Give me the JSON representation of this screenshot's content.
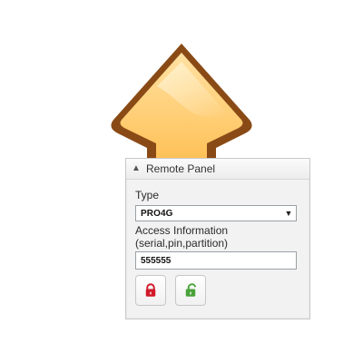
{
  "panel": {
    "title": "Remote Panel",
    "collapse_icon": "chevron-up-icon",
    "type_label": "Type",
    "type_value": "PRO4G",
    "access_label_line1": "Access Information",
    "access_label_line2": "(serial,pin,partition)",
    "access_value": "555555",
    "buttons": [
      {
        "icon": "lock-icon",
        "color": "#d11a2a"
      },
      {
        "icon": "unlock-icon",
        "color": "#4aa33a"
      }
    ]
  },
  "background_icon": {
    "icon": "upload-arrow-icon",
    "colors": {
      "fill_light": "#ffd07a",
      "fill_dark": "#f0a32b",
      "outline": "#8a4a16"
    }
  }
}
